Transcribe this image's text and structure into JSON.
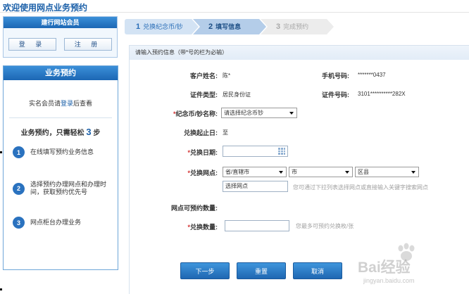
{
  "page": {
    "title": "欢迎使用网点业务预约"
  },
  "member": {
    "title": "建行网站会员",
    "login_label": "登 录",
    "register_label": "注 册"
  },
  "appointment": {
    "title": "业务预约",
    "login_tip_prefix": "实名会员请",
    "login_link": "登录",
    "login_tip_suffix": "后查看",
    "steps_title_prefix": "业务预约，只需轻松",
    "steps_count": "3",
    "steps_title_suffix": "步",
    "steps": [
      {
        "num": "1",
        "text": "在线填写预约业务信息"
      },
      {
        "num": "2",
        "text": "选择预约办理网点和办理时间，获取预约优先号"
      },
      {
        "num": "3",
        "text": "网点柜台办理业务"
      }
    ]
  },
  "stepbar": [
    {
      "num": "1",
      "label": "兑换纪念币/钞"
    },
    {
      "num": "2",
      "label": "填写信息"
    },
    {
      "num": "3",
      "label": "完成预约"
    }
  ],
  "form": {
    "header": "请输入预约信息（带*号的栏为必输）",
    "customer_name_label": "客户姓名:",
    "customer_name_value": "陈*",
    "phone_label": "手机号码:",
    "phone_value": "*******0437",
    "id_type_label": "证件类型:",
    "id_type_value": "居民身份证",
    "id_number_label": "证件号码:",
    "id_number_value": "3101**********282X",
    "coin_label": "纪念币/钞名称:",
    "coin_select": "请选择纪念币钞",
    "period_label": "兑换起止日:",
    "period_value": "至",
    "date_label": "兑换日期:",
    "branch_label": "兑换网点:",
    "province_select": "省/直辖市",
    "city_select": "市",
    "district_select": "区县",
    "branch_input": "选择网点",
    "branch_hint": "您可通过下拉列表选择网点或直接输入关键字搜索网点",
    "capacity_label": "网点可预约数量:",
    "qty_label": "兑换数量:",
    "qty_hint": "您最多可预约兑换枚/张",
    "required_mark": "*"
  },
  "actions": {
    "next": "下一步",
    "reset": "重置",
    "cancel": "取消"
  },
  "watermark": {
    "text": "Bai经验",
    "sub": "jingyan.baidu.com"
  }
}
